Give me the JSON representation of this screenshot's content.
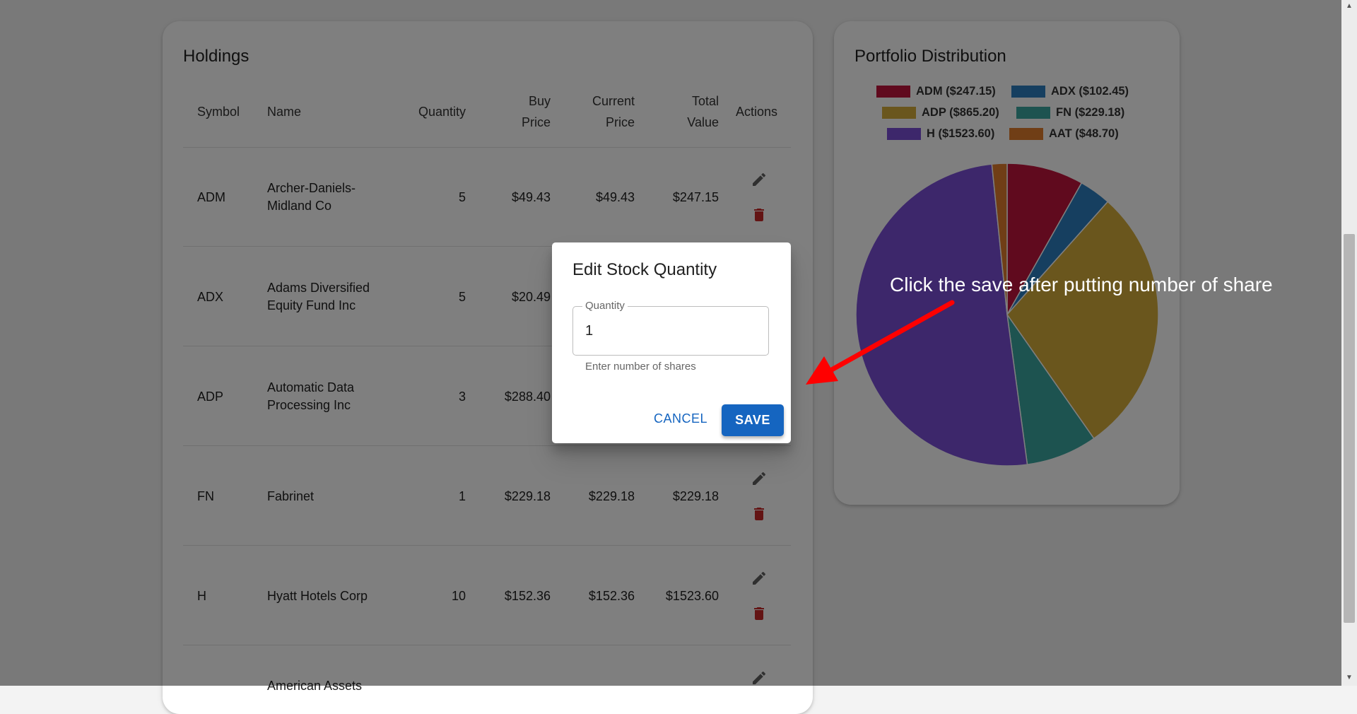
{
  "holdings": {
    "title": "Holdings",
    "columns": {
      "symbol": "Symbol",
      "name": "Name",
      "quantity": "Quantity",
      "buy_price_line1": "Buy",
      "buy_price_line2": "Price",
      "current_price_line1": "Current",
      "current_price_line2": "Price",
      "total_value_line1": "Total",
      "total_value_line2": "Value",
      "actions": "Actions"
    },
    "rows": [
      {
        "symbol": "ADM",
        "name_line1": "Archer-Daniels-",
        "name_line2": "Midland Co",
        "quantity": "5",
        "buy_price": "$49.43",
        "current_price": "$49.43",
        "total_value": "$247.15"
      },
      {
        "symbol": "ADX",
        "name_line1": "Adams Diversified",
        "name_line2": "Equity Fund Inc",
        "quantity": "5",
        "buy_price": "$20.49",
        "current_price": "",
        "total_value": ""
      },
      {
        "symbol": "ADP",
        "name_line1": "Automatic Data",
        "name_line2": "Processing Inc",
        "quantity": "3",
        "buy_price": "$288.40",
        "current_price": "",
        "total_value": ""
      },
      {
        "symbol": "FN",
        "name_line1": "Fabrinet",
        "name_line2": "",
        "quantity": "1",
        "buy_price": "$229.18",
        "current_price": "$229.18",
        "total_value": "$229.18"
      },
      {
        "symbol": "H",
        "name_line1": "Hyatt Hotels Corp",
        "name_line2": "",
        "quantity": "10",
        "buy_price": "$152.36",
        "current_price": "$152.36",
        "total_value": "$1523.60"
      },
      {
        "symbol": "",
        "name_line1": "American Assets",
        "name_line2": "",
        "quantity": "",
        "buy_price": "",
        "current_price": "",
        "total_value": ""
      }
    ]
  },
  "distribution": {
    "title": "Portfolio Distribution",
    "legend": [
      "ADM ($247.15)",
      "ADX ($102.45)",
      "ADP ($865.20)",
      "FN ($229.18)",
      "H ($1523.60)",
      "AAT ($48.70)"
    ]
  },
  "chart_data": {
    "type": "pie",
    "categories": [
      "ADM",
      "ADX",
      "ADP",
      "FN",
      "H",
      "AAT"
    ],
    "values": [
      247.15,
      102.45,
      865.2,
      229.18,
      1523.6,
      48.7
    ],
    "colors": [
      "#c0143c",
      "#2d7fc0",
      "#d4ac3a",
      "#3aa6a0",
      "#7a4fd6",
      "#e07c2c"
    ],
    "legend_labels": [
      "ADM ($247.15)",
      "ADX ($102.45)",
      "ADP ($865.20)",
      "FN ($229.18)",
      "H ($1523.60)",
      "AAT ($48.70)"
    ],
    "legend_position": "top"
  },
  "dialog": {
    "title": "Edit Stock Quantity",
    "quantity_label": "Quantity",
    "quantity_value": "1",
    "helper_text": "Enter number of shares",
    "cancel_label": "CANCEL",
    "save_label": "SAVE"
  },
  "annotation": {
    "text": "Click the save after putting number of share",
    "color": "#ff0000"
  },
  "icons": {
    "edit": "pencil-icon",
    "delete": "trash-icon"
  },
  "colors": {
    "primary": "#1565c0",
    "delete_icon": "#c62828"
  }
}
